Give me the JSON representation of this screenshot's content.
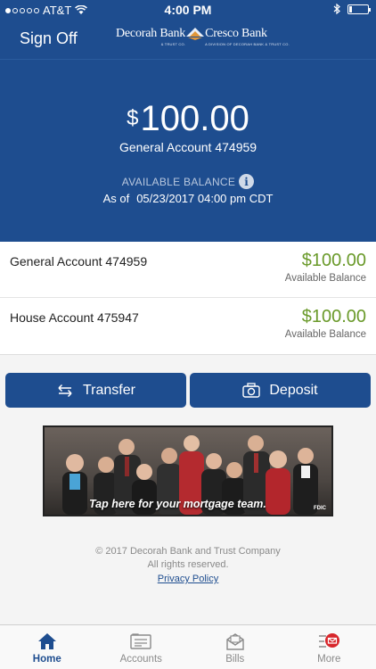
{
  "status_bar": {
    "carrier": "AT&T",
    "time": "4:00 PM",
    "signal_bars_filled": 1,
    "signal_bars_total": 5,
    "battery_level_fraction": 0.1
  },
  "nav": {
    "sign_off_label": "Sign Off",
    "logo": {
      "left_name": "Decorah Bank",
      "left_sub": "& TRUST CO.",
      "right_name": "Cresco Bank",
      "right_sub": "A DIVISION OF DECORAH BANK & TRUST CO."
    }
  },
  "balance": {
    "currency_symbol": "$",
    "amount": "100.00",
    "account": "General Account 474959",
    "available_label": "AVAILABLE BALANCE",
    "as_of_label": "As of",
    "as_of_value": "05/23/2017 04:00 pm CDT"
  },
  "accounts": [
    {
      "name": "General Account 474959",
      "balance": "$100.00",
      "balance_label": "Available Balance"
    },
    {
      "name": "House Account 475947",
      "balance": "$100.00",
      "balance_label": "Available Balance"
    }
  ],
  "actions": {
    "transfer_label": "Transfer",
    "deposit_label": "Deposit"
  },
  "banner": {
    "text": "Tap here for your mortgage team.",
    "badge": "FDIC"
  },
  "footer": {
    "copyright": "© 2017 Decorah Bank and Trust Company",
    "rights": "All rights reserved.",
    "privacy_label": "Privacy Policy"
  },
  "tabs": [
    {
      "label": "Home",
      "icon": "home-icon",
      "active": true
    },
    {
      "label": "Accounts",
      "icon": "accounts-icon",
      "active": false
    },
    {
      "label": "Bills",
      "icon": "bills-icon",
      "active": false
    },
    {
      "label": "More",
      "icon": "more-icon",
      "active": false
    }
  ],
  "colors": {
    "brand_blue": "#1e4d8f",
    "balance_green": "#6a9a2a",
    "notification_red": "#d7262b"
  }
}
